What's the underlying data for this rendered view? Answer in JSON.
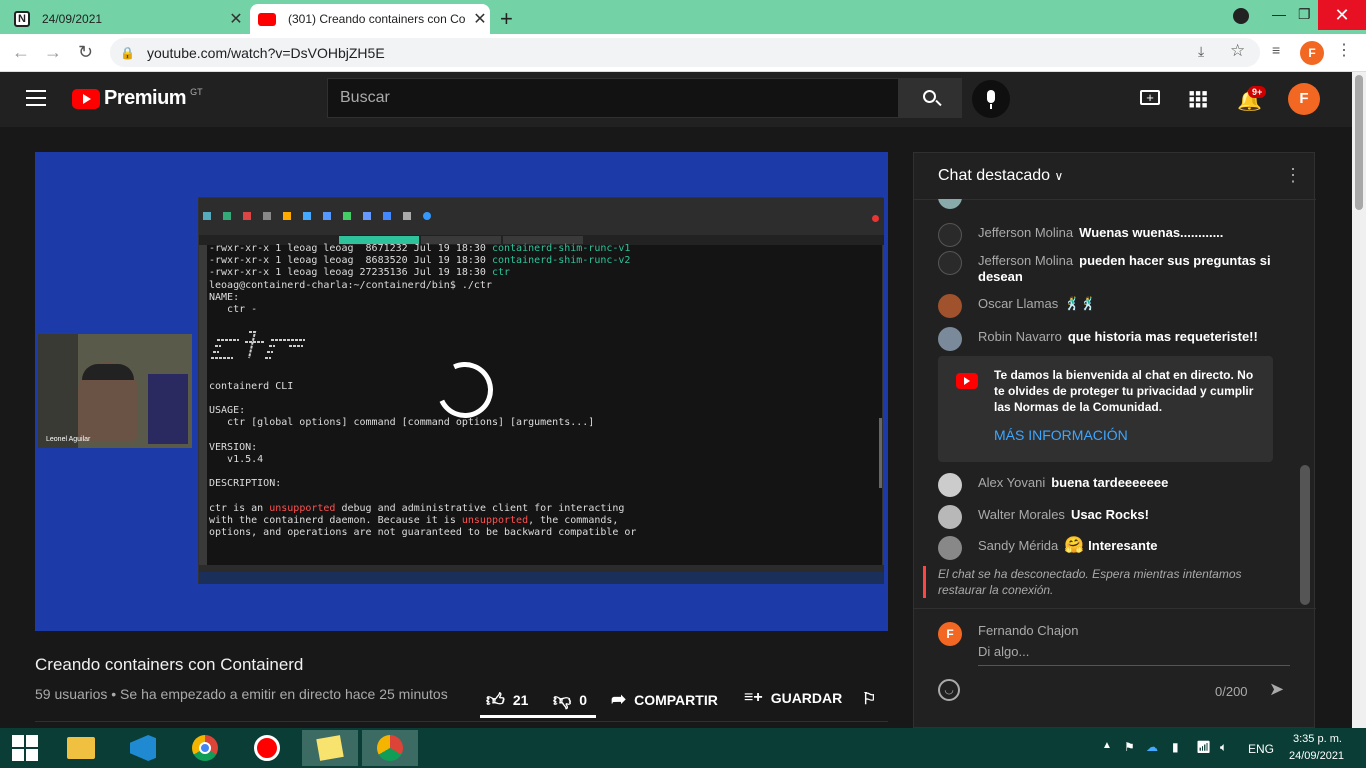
{
  "browser": {
    "tabs": [
      {
        "label": "24/09/2021",
        "icon": "notion-icon"
      },
      {
        "label": "(301) Creando containers con Co",
        "icon": "youtube-icon"
      }
    ],
    "url": "youtube.com/watch?v=DsVOHbjZH5E",
    "profile_initial": "F"
  },
  "youtube": {
    "logo_text": "Premium",
    "region": "GT",
    "search_placeholder": "Buscar",
    "notif_count": "9+",
    "avatar_initial": "F"
  },
  "terminal": {
    "lines": [
      {
        "pre": "-rwxr-xr-x 1 leoag leoag  8671232 Jul 19 18:30 ",
        "file": "containerd-shim-runc-v1"
      },
      {
        "pre": "-rwxr-xr-x 1 leoag leoag  8683520 Jul 19 18:30 ",
        "file": "containerd-shim-runc-v2"
      },
      {
        "pre": "-rwxr-xr-x 1 leoag leoag 27235136 Jul 19 18:30 ",
        "file": "ctr"
      }
    ],
    "prompt": "leoag@containerd-charla:~/containerd/bin$ ./ctr",
    "body1": "NAME:\n   ctr -\n\n",
    "cli": "containerd CLI",
    "usage": "\n\nUSAGE:\n   ctr [global options] command [command options] [arguments...]\n\nVERSION:\n   v1.5.4\n\nDESCRIPTION:\n",
    "desc_a": "ctr is an ",
    "unsupported1": "unsupported",
    "desc_b": " debug and administrative client for interacting\nwith the containerd daemon. Because it is ",
    "unsupported2": "unsupported",
    "desc_c": ", the commands,\noptions, and operations are not guaranteed to be backward compatible or",
    "cam_label": "Leonel Aguilar"
  },
  "video": {
    "title": "Creando containers con Containerd",
    "meta": "59 usuarios • Se ha empezado a emitir en directo hace 25 minutos",
    "likes": "21",
    "dislikes": "0",
    "share": "COMPARTIR",
    "save": "GUARDAR"
  },
  "chat": {
    "title": "Chat destacado",
    "messages": [
      {
        "author": "Jefferson Molina",
        "text": "Wuenas wuenas............"
      },
      {
        "author": "Jefferson Molina",
        "text": "pueden hacer sus preguntas si desean"
      },
      {
        "author": "Oscar Llamas",
        "text": ""
      },
      {
        "author": "Robin Navarro",
        "text": "que historia mas requeteriste!!"
      },
      {
        "author": "Alex Yovani",
        "text": "buena tardeeeeeee"
      },
      {
        "author": "Walter Morales",
        "text": "Usac Rocks!"
      },
      {
        "author": "Sandy Mérida",
        "text": "Interesante"
      }
    ],
    "notice": "Te damos la bienvenida al chat en directo. No te olvides de proteger tu privacidad y cumplir las Normas de la Comunidad.",
    "notice_link": "MÁS INFORMACIÓN",
    "disconnected": "El chat se ha desconectado. Espera mientras intentamos restaurar la conexión.",
    "user_name": "Fernando Chajon",
    "user_initial": "F",
    "input_placeholder": "Di algo...",
    "counter": "0/200"
  },
  "taskbar": {
    "lang": "ENG",
    "time": "3:35 p. m.",
    "date": "24/09/2021"
  }
}
